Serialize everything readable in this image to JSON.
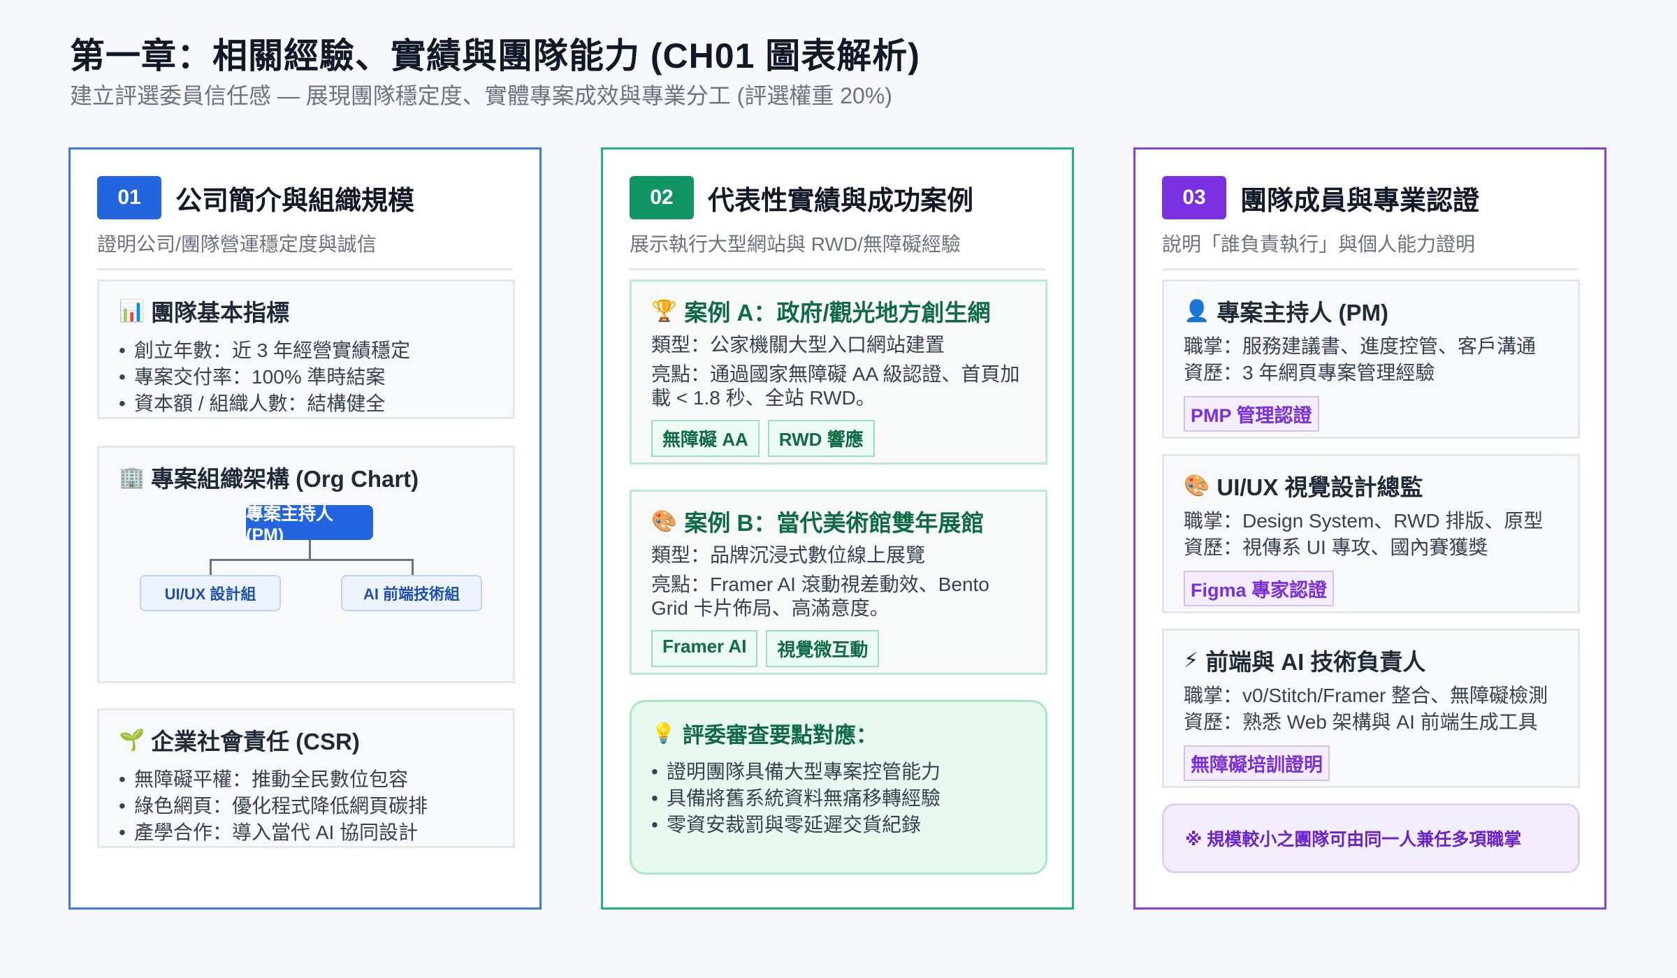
{
  "header": {
    "title": "第一章：相關經驗、實績與團隊能力 (CH01 圖表解析)",
    "subtitle": "建立評選委員信任感 — 展現團隊穩定度、實體專案成效與專業分工 (評選權重 20%)"
  },
  "col1": {
    "num": "01",
    "title": "公司簡介與組織規模",
    "desc": "證明公司/團隊營運穩定度與誠信",
    "metrics": {
      "icon": "📊",
      "title": "團隊基本指標",
      "items": [
        "創立年數：近 3 年經營實績穩定",
        "專案交付率：100% 準時結案",
        "資本額 / 組織人數：結構健全"
      ]
    },
    "org": {
      "icon": "🏢",
      "title": "專案組織架構 (Org Chart)",
      "pm": "專案主持人 (PM)",
      "left": "UI/UX 設計組",
      "right": "AI 前端技術組"
    },
    "csr": {
      "icon": "🌱",
      "title": "企業社會責任 (CSR)",
      "items": [
        "無障礙平權：推動全民數位包容",
        "綠色網頁：優化程式降低網頁碳排",
        "產學合作：導入當代 AI 協同設計"
      ]
    }
  },
  "col2": {
    "num": "02",
    "title": "代表性實績與成功案例",
    "desc": "展示執行大型網站與 RWD/無障礙經驗",
    "case_a": {
      "icon": "🏆",
      "title": "案例 A：政府/觀光地方創生網",
      "type": "類型：公家機關大型入口網站建置",
      "highlight": "亮點：通過國家無障礙 AA 級認證、首頁加載 < 1.8 秒、全站 RWD。",
      "tags": [
        "無障礙 AA",
        "RWD 響應"
      ]
    },
    "case_b": {
      "icon": "🎨",
      "title": "案例 B：當代美術館雙年展館",
      "type": "類型：品牌沉浸式數位線上展覽",
      "highlight": "亮點：Framer AI 滾動視差動效、Bento Grid 卡片佈局、高滿意度。",
      "tags": [
        "Framer AI",
        "視覺微互動"
      ]
    },
    "review": {
      "icon": "💡",
      "title": "評委審查要點對應：",
      "items": [
        "證明團隊具備大型專案控管能力",
        "具備將舊系統資料無痛移轉經驗",
        "零資安裁罰與零延遲交貨紀錄"
      ]
    }
  },
  "col3": {
    "num": "03",
    "title": "團隊成員與專業認證",
    "desc": "說明「誰負責執行」與個人能力證明",
    "roles": [
      {
        "icon": "👤",
        "title": "專案主持人 (PM)",
        "duty": "職掌：服務建議書、進度控管、客戶溝通",
        "exp": "資歷：3 年網頁專案管理經驗",
        "cert": "PMP 管理認證"
      },
      {
        "icon": "🎨",
        "title": "UI/UX 視覺設計總監",
        "duty": "職掌：Design System、RWD 排版、原型",
        "exp": "資歷：視傳系 UI 專攻、國內賽獲獎",
        "cert": "Figma 專家認證"
      },
      {
        "icon": "⚡",
        "title": "前端與 AI 技術負責人",
        "duty": "職掌：v0/Stitch/Framer 整合、無障礙檢測",
        "exp": "資歷：熟悉 Web 架構與 AI 前端生成工具",
        "cert": "無障礙培訓證明"
      }
    ],
    "note": "※ 規模較小之團隊可由同一人兼任多項職掌"
  },
  "colors": {
    "blue": "#2265de",
    "green": "#119463",
    "purple": "#7a2fe0",
    "border_blue": "#3b7be6",
    "border_green": "#22b57a",
    "border_purple": "#8b3fe0"
  }
}
